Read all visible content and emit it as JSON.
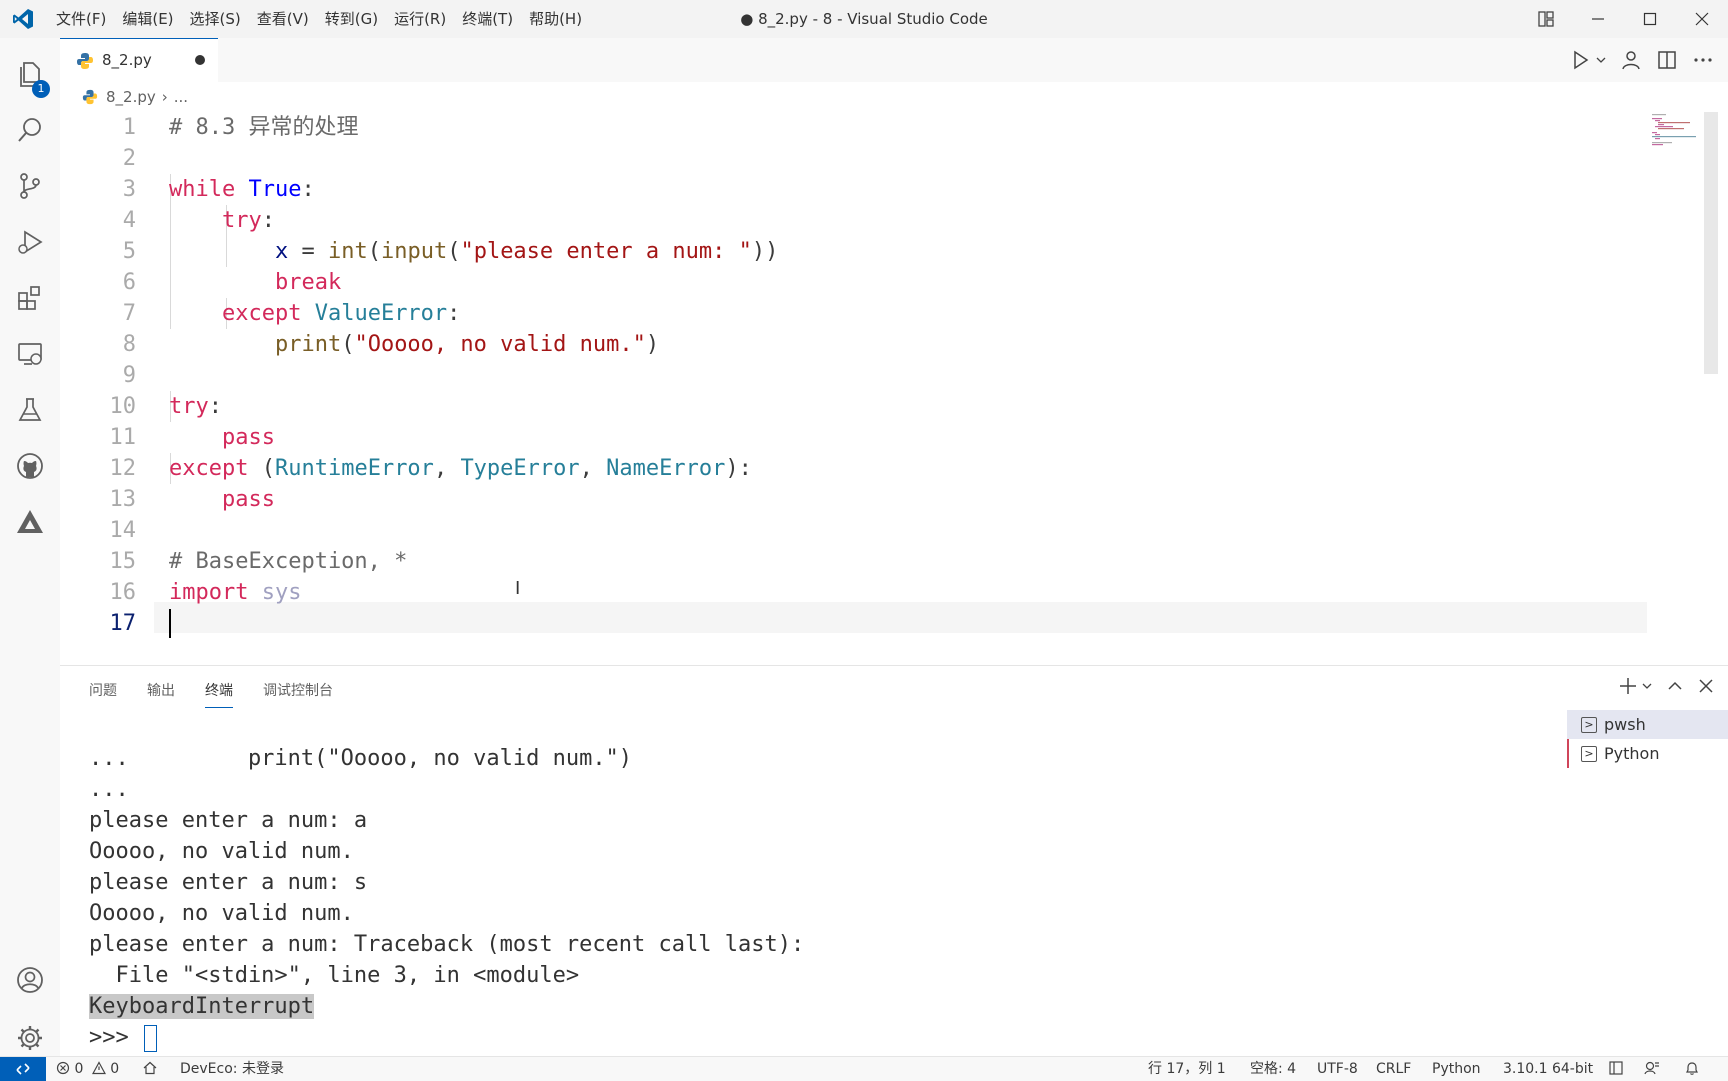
{
  "titlebar": {
    "menu": [
      "文件(F)",
      "编辑(E)",
      "选择(S)",
      "查看(V)",
      "转到(G)",
      "运行(R)",
      "终端(T)",
      "帮助(H)"
    ],
    "title": "● 8_2.py - 8 - Visual Studio Code"
  },
  "activity": {
    "explorer_badge": "1"
  },
  "tab": {
    "label": "8_2.py"
  },
  "breadcrumb": {
    "file": "8_2.py",
    "sep": "›",
    "more": "..."
  },
  "editor": {
    "line_numbers": [
      "1",
      "2",
      "3",
      "4",
      "5",
      "6",
      "7",
      "8",
      "9",
      "10",
      "11",
      "12",
      "13",
      "14",
      "15",
      "16",
      "17"
    ],
    "code": {
      "l1": "# 8.3 异常的处理",
      "l3_kw": "while",
      "l3_lit": "True",
      "l3_p": ":",
      "l4_kw": "try",
      "l4_p": ":",
      "l5_var": "x",
      "l5_op": " = ",
      "l5_fn1": "int",
      "l5_p1": "(",
      "l5_fn2": "input",
      "l5_p2": "(",
      "l5_str": "\"please enter a num: \"",
      "l5_p3": "))",
      "l6_kw": "break",
      "l7_kw": "except",
      "l7_cls": "ValueError",
      "l7_p": ":",
      "l8_fn": "print",
      "l8_p1": "(",
      "l8_str": "\"Ooooo, no valid num.\"",
      "l8_p2": ")",
      "l10_kw": "try",
      "l10_p": ":",
      "l11_kw": "pass",
      "l12_kw": "except",
      "l12_p1": " (",
      "l12_c1": "RuntimeError",
      "l12_s1": ", ",
      "l12_c2": "TypeError",
      "l12_s2": ", ",
      "l12_c3": "NameError",
      "l12_p2": "):",
      "l13_kw": "pass",
      "l15": "# BaseException, *",
      "l16_kw": "import",
      "l16_mod": "sys"
    }
  },
  "panel": {
    "tabs": [
      "问题",
      "输出",
      "终端",
      "调试控制台"
    ],
    "terminal_lines": [
      "...         print(\"Ooooo, no valid num.\")",
      "...",
      "please enter a num: a",
      "Ooooo, no valid num.",
      "please enter a num: s",
      "Ooooo, no valid num.",
      "please enter a num: Traceback (most recent call last):",
      "  File \"<stdin>\", line 3, in <module>"
    ],
    "terminal_highlight": "KeyboardInterrupt",
    "prompt": ">>> ",
    "terminals": [
      "pwsh",
      "Python"
    ]
  },
  "status": {
    "errors": "0",
    "warnings": "0",
    "deveco": "DevEco: 未登录",
    "position": "行 17，列 1",
    "spaces": "空格: 4",
    "encoding": "UTF-8",
    "eol": "CRLF",
    "language": "Python",
    "interpreter": "3.10.1 64-bit"
  },
  "colors": {
    "accent": "#005fb8",
    "keyword": "#af00db",
    "string": "#a31515",
    "class": "#267f99"
  }
}
